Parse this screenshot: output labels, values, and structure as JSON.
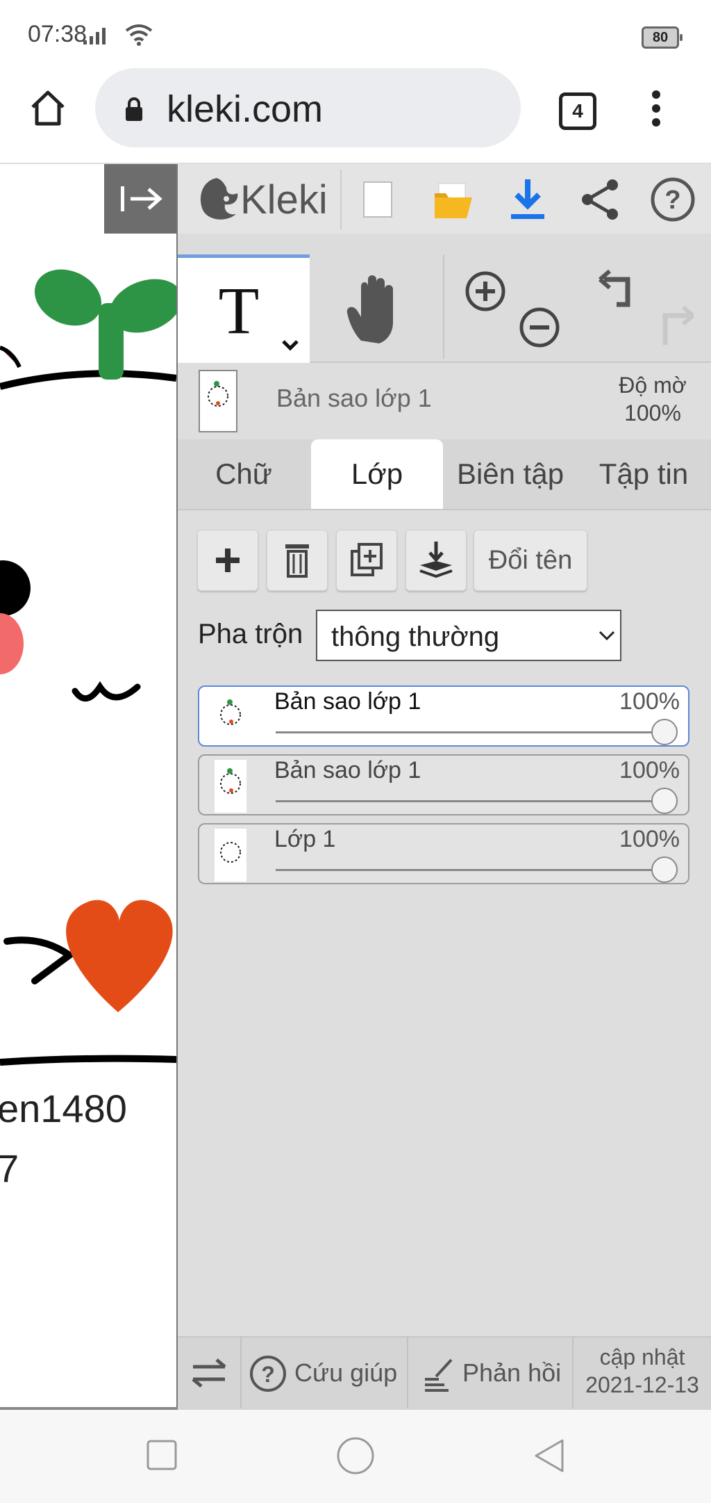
{
  "status_bar": {
    "time": "07:38",
    "battery": "80"
  },
  "browser": {
    "url": "kleki.com",
    "tab_count": "4"
  },
  "canvas": {
    "text_line1": "en1480",
    "text_line2": "7"
  },
  "app": {
    "logo_text": "Kleki"
  },
  "layer_info": {
    "name": "Bản sao lớp 1",
    "opacity_label": "Độ mờ",
    "opacity_value": "100%"
  },
  "tabs": [
    "Chữ",
    "Lớp",
    "Biên tập",
    "Tập tin"
  ],
  "layer_actions": {
    "rename_label": "Đổi tên"
  },
  "blend": {
    "label": "Pha trộn",
    "value": "thông thường"
  },
  "layers": [
    {
      "name": "Bản sao lớp 1",
      "opacity": "100%",
      "opacity_fraction": 1.0,
      "selected": true
    },
    {
      "name": "Bản sao lớp 1",
      "opacity": "100%",
      "opacity_fraction": 1.0,
      "selected": false
    },
    {
      "name": "Lớp 1",
      "opacity": "100%",
      "opacity_fraction": 1.0,
      "selected": false
    }
  ],
  "bottom_bar": {
    "help_label": "Cứu giúp",
    "feedback_label": "Phản hồi",
    "update_label": "cập nhật",
    "update_date": "2021-12-13"
  },
  "colors": {
    "selection_blue": "#5e88d8",
    "download_blue": "#1a73e8",
    "folder_yellow": "#f5b820",
    "heart": "#e34b17",
    "sprout": "#2e9445"
  }
}
